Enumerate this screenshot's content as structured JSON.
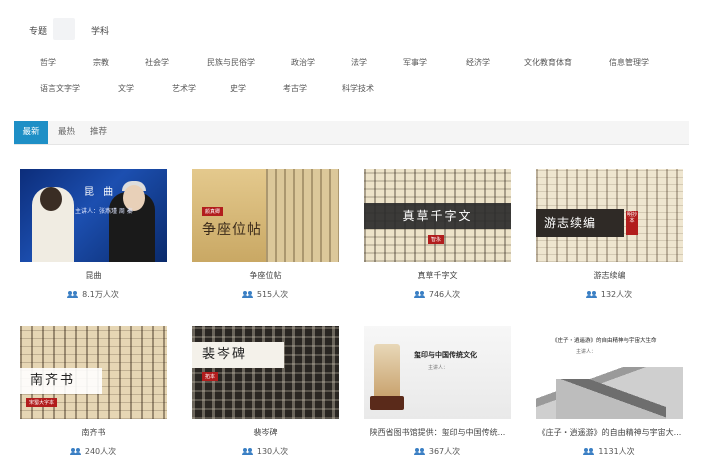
{
  "tabs": {
    "topic": "专题",
    "subject": "学科"
  },
  "subjects_row1": [
    "哲学",
    "宗教",
    "社会学",
    "民族与民俗学",
    "政治学",
    "法学",
    "军事学",
    "经济学",
    "文化教育体育",
    "信息管理学"
  ],
  "subjects_row2": [
    "语言文字学",
    "文学",
    "艺术学",
    "史学",
    "考古学",
    "科学技术"
  ],
  "sort": {
    "newest": "最新",
    "hot": "最热",
    "recommend": "推荐"
  },
  "colors": {
    "accent": "#1e8fc6",
    "users_icon": "#3a7fc4"
  },
  "cards": [
    {
      "title": "昆曲",
      "views": "8.1万人次",
      "thumb_title": "昆 曲",
      "thumb_sub": "主讲人：张燕瑾 周 秦"
    },
    {
      "title": "争座位帖",
      "views": "515人次",
      "thumb_title": "争座位帖",
      "thumb_seal": "颜真卿"
    },
    {
      "title": "真草千字文",
      "views": "746人次",
      "thumb_title": "真草千字文",
      "thumb_seal": "智永"
    },
    {
      "title": "游志续编",
      "views": "132人次",
      "thumb_title": "游志续编",
      "thumb_seal": "明抄本"
    },
    {
      "title": "南齐书",
      "views": "240人次",
      "thumb_title": "南齐书",
      "thumb_seal": "宋蜀大字本"
    },
    {
      "title": "裴岑碑",
      "views": "130人次",
      "thumb_title": "裴岑碑",
      "thumb_seal": "拓本"
    },
    {
      "title": "陕西省图书馆提供：玺印与中国传统...",
      "views": "367人次",
      "thumb_title": "玺印与中国传统文化",
      "thumb_sub": "主讲人："
    },
    {
      "title": "《庄子・逍遥游》的自由精神与宇宙大...",
      "views": "1131人次",
      "thumb_title": "《庄子・逍遥游》的自由精神与宇宙大生命",
      "thumb_sub": "主讲人："
    }
  ]
}
